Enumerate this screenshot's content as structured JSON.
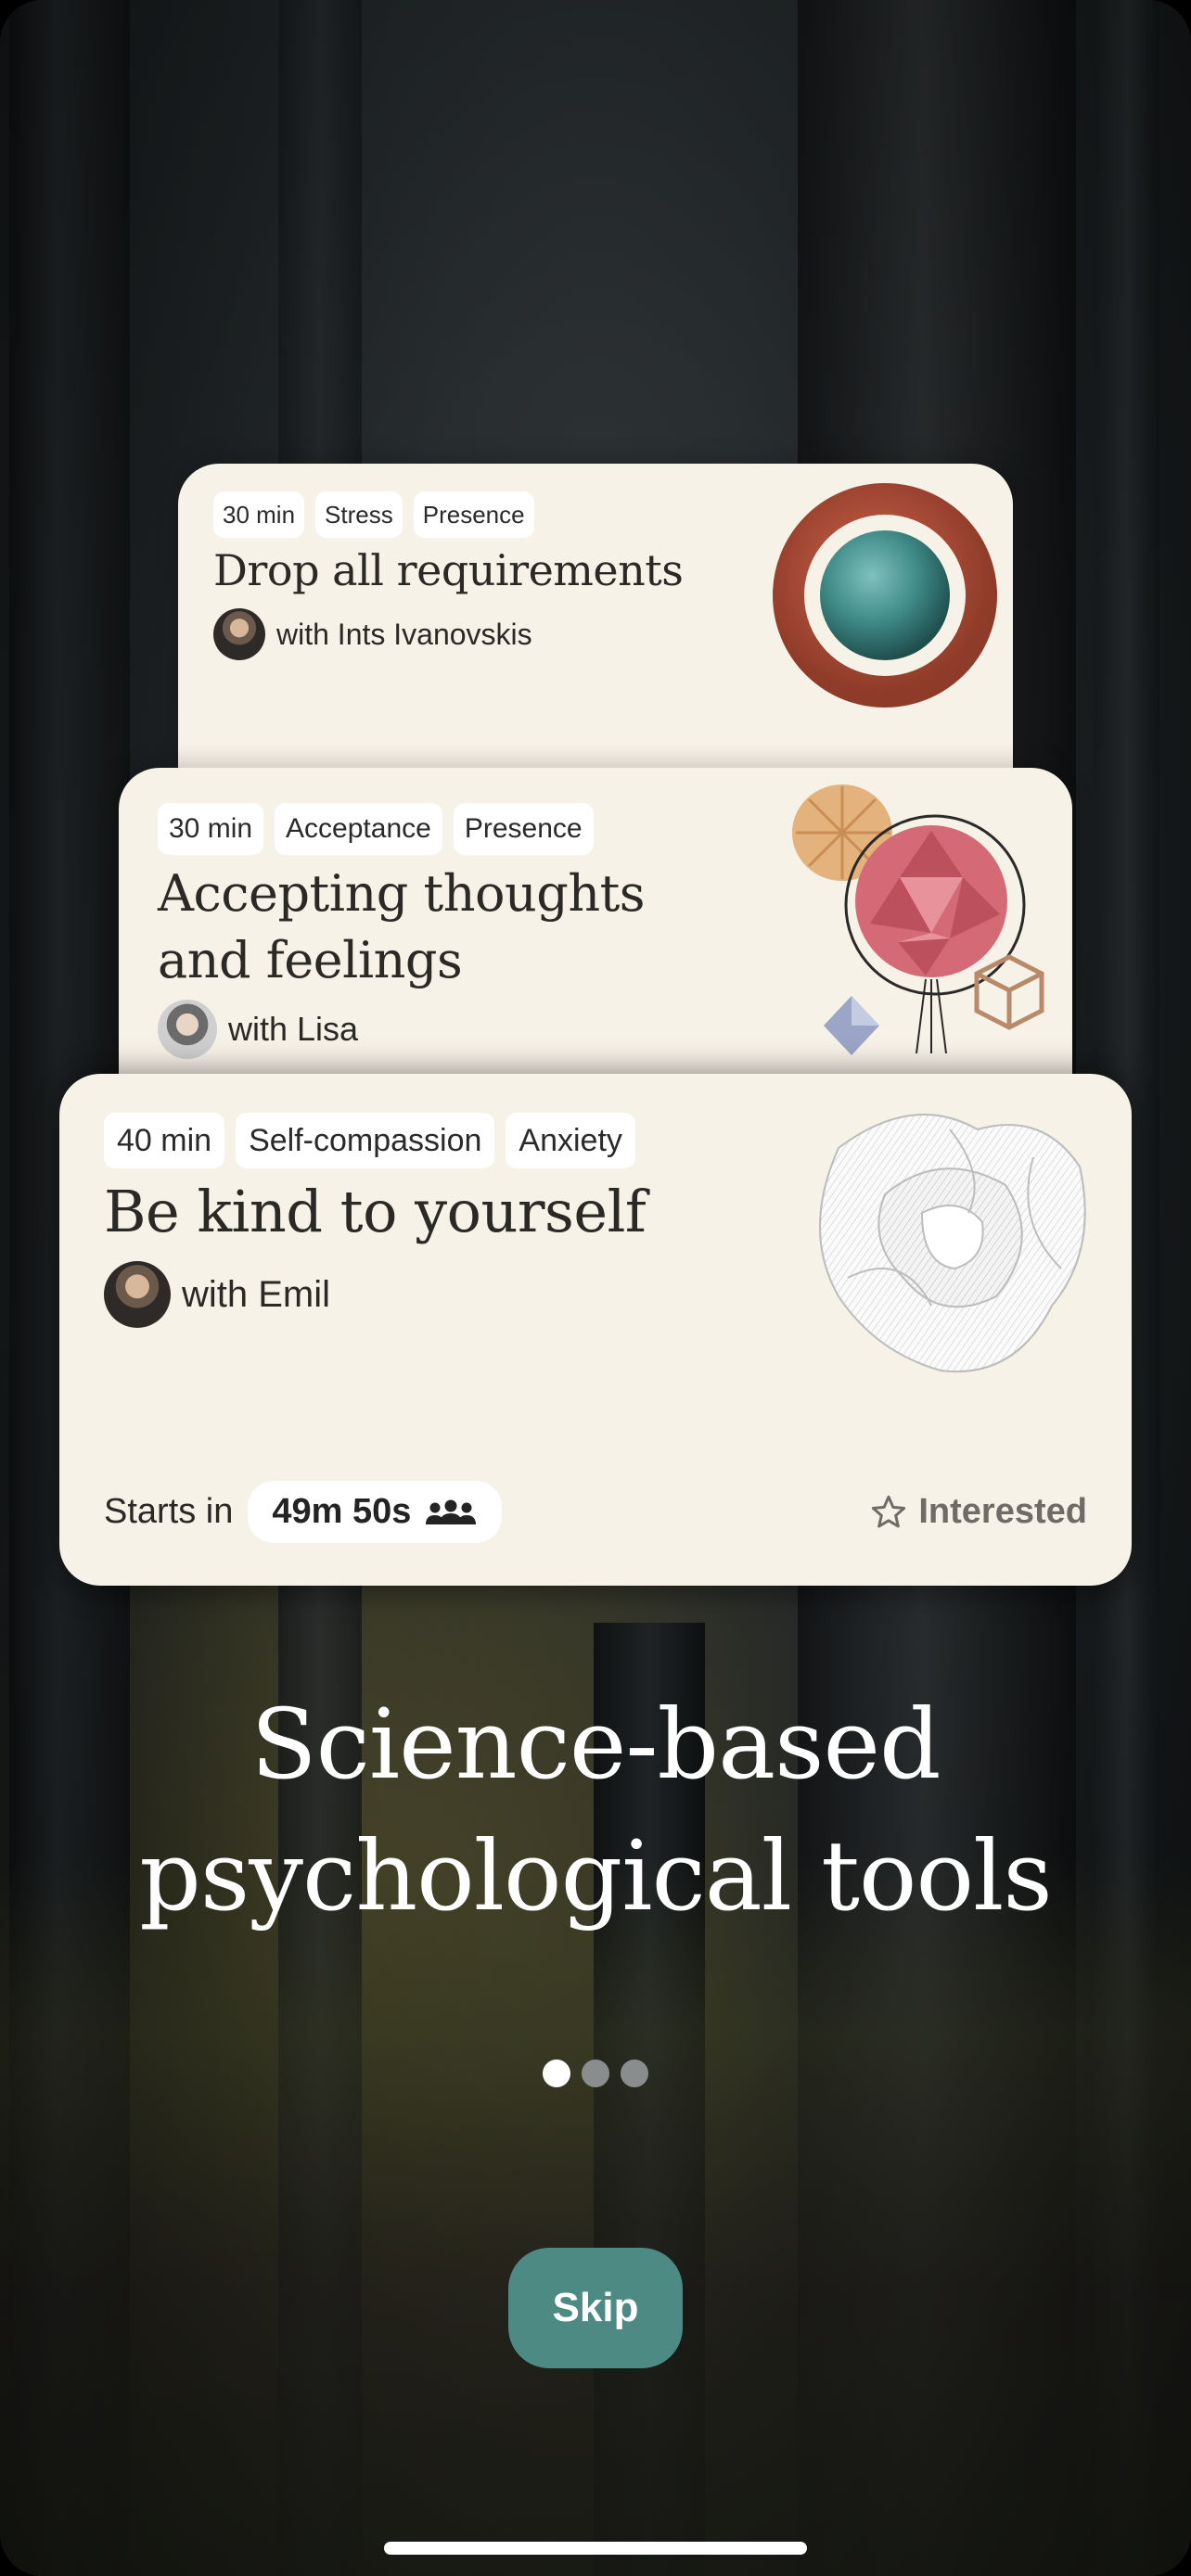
{
  "cards": [
    {
      "tags": [
        "30 min",
        "Stress",
        "Presence"
      ],
      "title": "Drop all requirements",
      "host": "with Ints Ivanovskis",
      "art_icon": "ring-orb-icon"
    },
    {
      "tags": [
        "30 min",
        "Acceptance",
        "Presence"
      ],
      "title": "Accepting thoughts and feelings",
      "host": "with Lisa",
      "art_icon": "geometric-shapes-icon"
    },
    {
      "tags": [
        "40 min",
        "Self-compassion",
        "Anxiety"
      ],
      "title": "Be kind to yourself",
      "host": "with Emil",
      "art_icon": "paper-rose-icon",
      "starts_label": "Starts in",
      "timer": "49m 50s",
      "interested_label": "Interested"
    }
  ],
  "headline": {
    "line1": "Science-based",
    "line2": "psychological tools"
  },
  "pagination": {
    "total": 3,
    "active": 1
  },
  "skip_label": "Skip",
  "colors": {
    "card_bg": "#f7f2e7",
    "skip_button": "#4c8a83",
    "ring": "#b3503a",
    "orb": "#3f8a87"
  }
}
